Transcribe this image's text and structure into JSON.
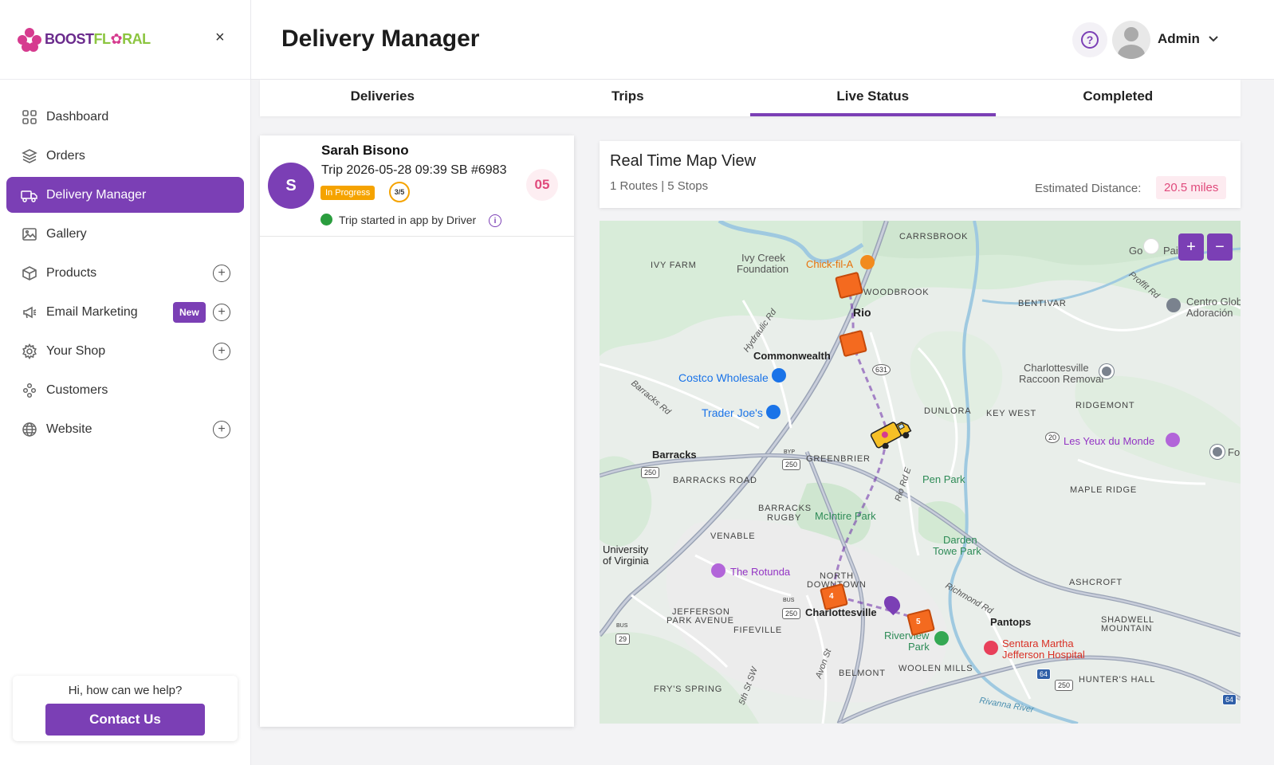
{
  "brand": {
    "part1": "BOOST",
    "part2": "FL",
    "part3": "RAL"
  },
  "sidebar": {
    "close": "×",
    "items": [
      {
        "label": "Dashboard",
        "icon": "grid-icon"
      },
      {
        "label": "Orders",
        "icon": "layers-icon"
      },
      {
        "label": "Delivery Manager",
        "icon": "delivery-truck-icon",
        "active": true
      },
      {
        "label": "Gallery",
        "icon": "image-icon"
      },
      {
        "label": "Products",
        "icon": "box-icon",
        "plus": "+"
      },
      {
        "label": "Email Marketing",
        "icon": "megaphone-icon",
        "badge": "New",
        "plus": "+"
      },
      {
        "label": "Your Shop",
        "icon": "gear-icon",
        "plus": "+"
      },
      {
        "label": "Customers",
        "icon": "users-icon"
      },
      {
        "label": "Website",
        "icon": "globe-icon",
        "plus": "+"
      }
    ],
    "help_text": "Hi, how can we help?",
    "contact_label": "Contact Us"
  },
  "header": {
    "title": "Delivery Manager",
    "help_glyph": "?",
    "user_name": "Admin",
    "caret": "⌄"
  },
  "tabs": [
    "Deliveries",
    "Trips",
    "Live Status",
    "Completed"
  ],
  "active_tab": "Live Status",
  "trip": {
    "initial": "S",
    "driver": "Sarah Bisono",
    "trip_line": "Trip 2026-05-28 09:39 SB #6983",
    "status": "In Progress",
    "progress": "3/5",
    "started": "Trip started in app by Driver",
    "info_glyph": "i",
    "stops": "05"
  },
  "map_panel": {
    "title": "Real Time Map View",
    "subtitle": "1 Routes | 5 Stops",
    "distance_label": "Estimated Distance:",
    "distance_value": "20.5 miles",
    "zoom_in": "+",
    "zoom_out": "−"
  },
  "map_labels": {
    "carrsbrook": "CARRSBROOK",
    "ivy_farm": "IVY FARM",
    "ivy_creek": "Ivy Creek",
    "foundation": "Foundation",
    "chickfila": "Chick-fil-A",
    "woodbrook": "WOODBROOK",
    "rio": "Rio",
    "bentivar": "BENTIVAR",
    "go": "Go",
    "pai": "Pai",
    "centro1": "Centro Glob",
    "centro2": "Adoración",
    "commonwealth": "Commonwealth",
    "hydraulic": "Hydraulic Rd",
    "costco": "Costco Wholesale",
    "cville_raccoon1": "Charlottesville",
    "cville_raccoon2": "Raccoon Removal",
    "barracks_rd": "Barracks Rd",
    "traderjoes": "Trader Joe's",
    "dunlora": "DUNLORA",
    "key_west": "KEY WEST",
    "ridgemont": "RIDGEMONT",
    "les_yeux": "Les Yeux du Monde",
    "fo": "Fo",
    "barracks": "Barracks",
    "greenbrier": "GREENBRIER",
    "barracks_road": "BARRACKS ROAD",
    "pen_park": "Pen Park",
    "maple_ridge": "MAPLE RIDGE",
    "barracks_rugby1": "BARRACKS",
    "barracks_rugby2": "RUGBY",
    "mcintire": "McIntire Park",
    "venable": "VENABLE",
    "uva1": "University",
    "uva2": "of Virginia",
    "darden1": "Darden",
    "darden2": "Towe Park",
    "rotunda": "The Rotunda",
    "north_downtown1": "NORTH",
    "north_downtown2": "DOWNTOWN",
    "ashcroft": "ASHCROFT",
    "jefferson_park1": "JEFFERSON",
    "jefferson_park2": "PARK AVENUE",
    "charlottesville": "Charlottesville",
    "pantops": "Pantops",
    "shadwell1": "SHADWELL",
    "shadwell2": "MOUNTAIN",
    "fifeville": "FIFEVILLE",
    "riverview1": "Riverview",
    "riverview2": "Park",
    "sentara1": "Sentara Martha",
    "sentara2": "Jefferson Hospital",
    "richmond_rd": "Richmond Rd",
    "belmont": "BELMONT",
    "woolen_mills": "WOOLEN MILLS",
    "hunters_hall": "HUNTER'S HALL",
    "frys_spring": "FRY'S SPRING",
    "rivanna_river": "Rivanna River",
    "rio_rd": "Rio Rd E",
    "proffit": "Proffit Rd",
    "avon": "Avon St",
    "fifth": "5th St SW",
    "route_631": "631",
    "route_250": "250",
    "route_29": "29",
    "route_20": "20",
    "route_64": "64",
    "bus": "BUS",
    "byp": "BYP",
    "pkg4": "4",
    "pkg5": "5"
  },
  "colors": {
    "accent": "#7b3fb5",
    "status_orange": "#f5a300",
    "pink": "#e04a7c",
    "green_dot": "#2a9d3e",
    "package": "#f46a1f"
  }
}
